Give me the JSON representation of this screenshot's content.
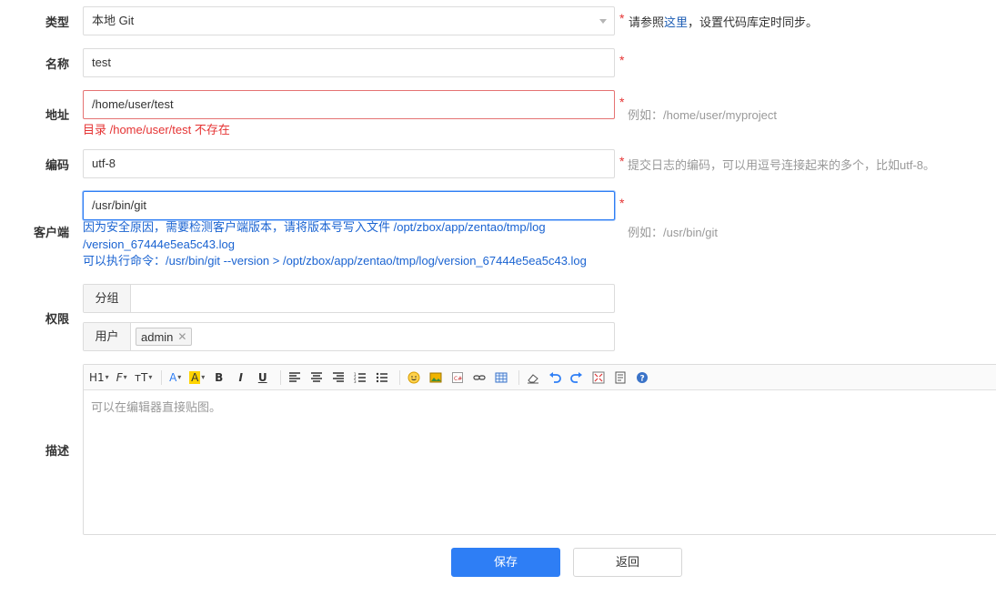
{
  "form": {
    "type": {
      "label": "类型",
      "value": "本地 Git",
      "help_prefix": "请参照",
      "help_link": "这里",
      "help_suffix": "，设置代码库定时同步。"
    },
    "name": {
      "label": "名称",
      "value": "test"
    },
    "path": {
      "label": "地址",
      "value": "/home/user/test",
      "error": "目录 /home/user/test 不存在",
      "help": "例如：/home/user/myproject"
    },
    "encoding": {
      "label": "编码",
      "value": "utf-8",
      "help": "提交日志的编码，可以用逗号连接起来的多个，比如utf-8。"
    },
    "client": {
      "label": "客户端",
      "value": "/usr/bin/git",
      "info_line1": "因为安全原因，需要检测客户端版本，请将版本号写入文件 /opt/zbox/app/zentao/tmp/log",
      "info_line2": "/version_67444e5ea5c43.log",
      "info_line3": "可以执行命令：/usr/bin/git --version > /opt/zbox/app/zentao/tmp/log/version_67444e5ea5c43.log",
      "help": "例如：/usr/bin/git"
    },
    "acl": {
      "label": "权限",
      "group_addon": "分组",
      "user_addon": "用户",
      "users": [
        "admin"
      ]
    },
    "desc": {
      "label": "描述",
      "placeholder": "可以在编辑器直接贴图。"
    },
    "required_mark": "*"
  },
  "toolbar": {
    "heading": "H1",
    "font_family": "F",
    "font_size": "тT",
    "font_color": "A",
    "bg_color": "A",
    "bold": "B",
    "italic": "I",
    "underline": "U"
  },
  "buttons": {
    "save": "保存",
    "back": "返回"
  },
  "colors": {
    "primary": "#2e7ef5",
    "error": "#e53333",
    "info": "#1a63d1"
  }
}
